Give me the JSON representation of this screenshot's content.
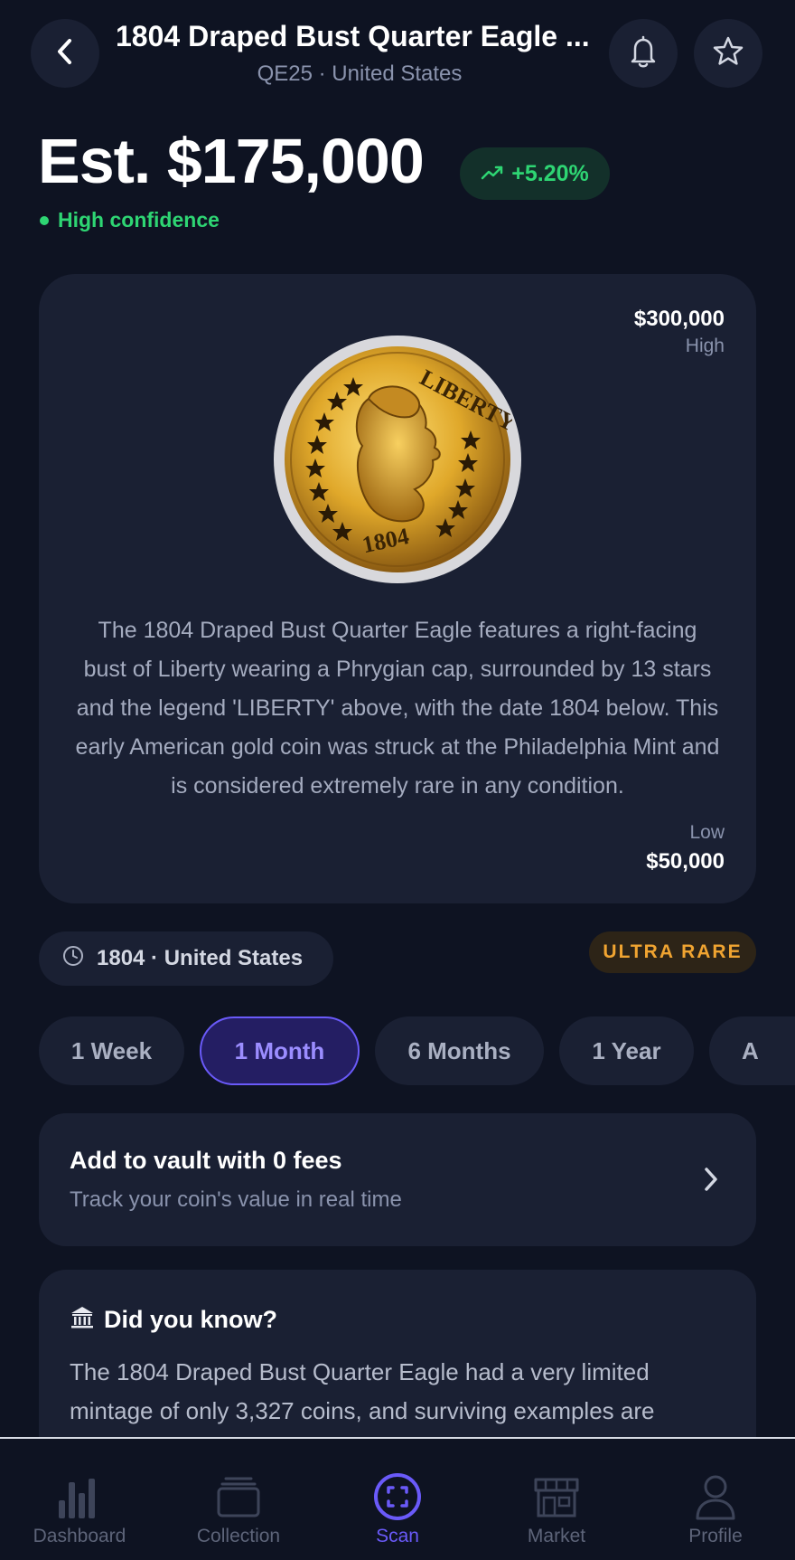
{
  "header": {
    "title": "1804 Draped Bust Quarter Eagle ...",
    "subtitle": "QE25 · United States",
    "back_icon": "chevron-left-icon",
    "bell_icon": "bell-icon",
    "star_icon": "star-icon"
  },
  "estimate": {
    "value": "Est. $175,000",
    "change": "+5.20%",
    "confidence": "High confidence",
    "colors": {
      "positive": "#2ed573"
    }
  },
  "coin_card": {
    "high_value": "$300,000",
    "high_label": "High",
    "low_label": "Low",
    "low_value": "$50,000",
    "coin_legend": "LIBERTY",
    "coin_date": "1804",
    "description": "The 1804 Draped Bust Quarter Eagle features a right-facing bust of Liberty wearing a Phrygian cap, surrounded by 13 stars and the legend 'LIBERTY' above, with the date 1804 below. This early American gold coin was struck at the Philadelphia Mint and is considered extremely rare in any condition."
  },
  "meta": {
    "year_country": "1804 · United States",
    "rarity": "ULTRA RARE"
  },
  "ranges": {
    "tabs": [
      "1 Week",
      "1 Month",
      "6 Months",
      "1 Year",
      "A"
    ],
    "selected": "1 Month"
  },
  "vault": {
    "title": "Add to vault with 0 fees",
    "subtitle": "Track your coin's value in real time"
  },
  "did_you_know": {
    "title": "Did you know?",
    "body": "The 1804 Draped Bust Quarter Eagle had a very limited mintage of only 3,327 coins, and surviving examples are"
  },
  "nav": {
    "items": [
      {
        "label": "Dashboard",
        "icon": "bar-chart-icon"
      },
      {
        "label": "Collection",
        "icon": "stack-icon"
      },
      {
        "label": "Scan",
        "icon": "scan-icon"
      },
      {
        "label": "Market",
        "icon": "store-icon"
      },
      {
        "label": "Profile",
        "icon": "user-icon"
      }
    ],
    "active": "Scan",
    "colors": {
      "accent": "#6a5af9",
      "inactive": "#5d6479"
    }
  }
}
